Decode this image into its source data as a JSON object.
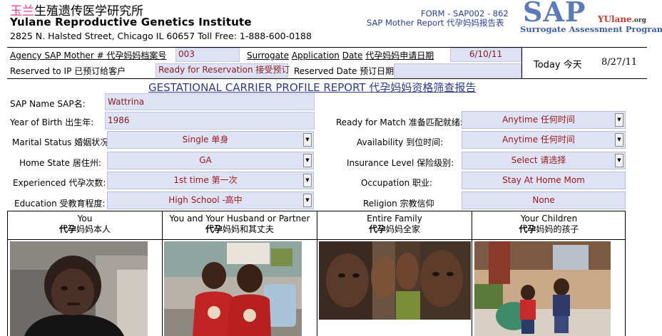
{
  "header": {
    "brand_cn_accent": "玉兰",
    "brand_cn_rest": "生殖遗传医学研究所",
    "brand_en": "Yulane Reproductive Genetics Institute",
    "address": "2825 N. Halsted Street, Chicago IL 60657  Toll Free: 1-888-600-0188",
    "form_id": "FORM - SAP002 - 862",
    "form_title": "SAP Mother Report 代孕妈妈报告表",
    "logo_sap": "SAP",
    "logo_yu": "YUlane",
    "logo_yu_suffix": ".org",
    "logo_tagline": "Surrogate Assessment Program"
  },
  "agency": {
    "label": "Agency SAP Mother # 代孕妈妈档案号",
    "value": "003",
    "application_label_1": "Surrogate",
    "application_label_2": "Application",
    "application_label_3": "Date",
    "application_label_cn": "代孕妈妈申请日期",
    "application_date": "6/10/11",
    "today_label": "Today 今天",
    "today_value": "8/27/11"
  },
  "reservation": {
    "label": "Reserved to IP  已预订给客户",
    "status": "Ready for Reservation 接受预订",
    "date_label": "Reserved Date 预订日期",
    "date_value": ""
  },
  "report_title": "GESTATIONAL CARRIER PROFILE REPORT 代孕妈妈资格筛查报告",
  "profile": {
    "sap_name_label": "SAP Name SAP名:",
    "sap_name": "Wattrina",
    "birth_label": "Year of Birth 出生年:",
    "birth_year": "1986",
    "marital_label": "Marital Status 婚姻状况:",
    "marital": "Single 单身",
    "state_label": "Home State 居住州:",
    "state": "GA",
    "experience_label": "Experienced 代孕次数:",
    "experience": "1st time  第一次",
    "education_label": "Education 受教育程度:",
    "education": "High School -高中",
    "ready_label": "Ready for Match 准备匹配就绪:",
    "ready": "Anytime 任何时间",
    "availability_label": "Availability 到位时间:",
    "availability": "Anytime 任何时间",
    "insurance_label": "Insurance Level 保险级别:",
    "insurance": "Select 请选择",
    "occupation_label": "Occupation 职业:",
    "occupation": "Stay At Home Mom",
    "religion_label": "Religion 宗教信仰",
    "religion": "None"
  },
  "photos": [
    {
      "en": "You",
      "cn_bold": "代孕",
      "cn_rest": "妈妈本人"
    },
    {
      "en": "You and Your Husband or Partner",
      "cn_bold": "代孕",
      "cn_rest": "妈妈和其丈夫"
    },
    {
      "en": "Entire Family",
      "cn_bold": "代孕",
      "cn_rest": "妈妈全家"
    },
    {
      "en": "Your Children",
      "cn_bold": "代孕",
      "cn_rest": "妈妈的孩子"
    }
  ],
  "colors": {
    "accent_pink": "#e23a8c",
    "field_bg": "#dde2f5",
    "value_red": "#a01919",
    "title_blue": "#2d3a8c",
    "logo_blue": "#5b7cb8"
  }
}
